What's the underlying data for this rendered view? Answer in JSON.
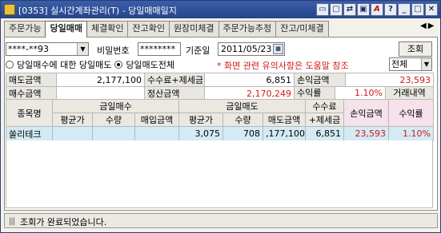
{
  "window": {
    "title": "[0353] 실시간계좌관리(T) - 당일매매일지"
  },
  "titlebar_buttons": [
    "restore-icon",
    "pin-icon",
    "link-icon",
    "help-icon",
    "question-icon",
    "minimize-icon",
    "maximize-icon",
    "close-icon"
  ],
  "tabs": [
    {
      "label": "주문가능",
      "active": false
    },
    {
      "label": "당일매매",
      "active": true
    },
    {
      "label": "체결확인",
      "active": false
    },
    {
      "label": "잔고확인",
      "active": false
    },
    {
      "label": "원장미체결",
      "active": false
    },
    {
      "label": "주문가능추정",
      "active": false
    },
    {
      "label": "잔고/미체결",
      "active": false
    }
  ],
  "form": {
    "account": "****-**93",
    "password_label": "비밀번호",
    "password": "********",
    "date_label": "기준일",
    "date": "2011/05/23",
    "query_button": "조회",
    "radio1": "당일매수에 대한 당일매도",
    "radio2": "당일매도전체",
    "notice": "* 화면 관련 유의사항은 도움말 참조",
    "filter": "전체"
  },
  "summary": {
    "sell_amount_label": "매도금액",
    "sell_amount": "2,177,100",
    "fee_tax_label": "수수료+제세금",
    "fee_tax": "6,851",
    "profit_label": "손익금액",
    "profit": "23,593",
    "buy_amount_label": "매수금액",
    "buy_amount": "",
    "settle_label": "정산금액",
    "settle": "2,170,249",
    "return_label": "수익률",
    "return_rate": "1.10%",
    "history_label": "거래내역"
  },
  "grid": {
    "headers": {
      "name": "종목명",
      "buy_group": "금일매수",
      "sell_group": "금일매도",
      "fee_top": "수수료",
      "fee_bottom": "+제세금",
      "profit": "손익금액",
      "return": "수익률",
      "buy_avg": "평균가",
      "buy_qty": "수량",
      "buy_amt": "매입금액",
      "sell_avg": "평균가",
      "sell_qty": "수량",
      "sell_amt": "매도금액"
    },
    "rows": [
      {
        "name": "쏠리테크",
        "buy_avg": "",
        "buy_qty": "",
        "buy_amt": "",
        "sell_avg": "3,075",
        "sell_qty": "708",
        "sell_amt": ",177,100",
        "fee": "6,851",
        "profit": "23,593",
        "return": "1.10%"
      }
    ]
  },
  "status": {
    "message": "조회가 완료되었습니다."
  },
  "colors": {
    "title_bar": "#26458a",
    "profit_red": "#d01818",
    "selected_row": "#d4eaf4",
    "pink_header": "#f6e2ea"
  }
}
